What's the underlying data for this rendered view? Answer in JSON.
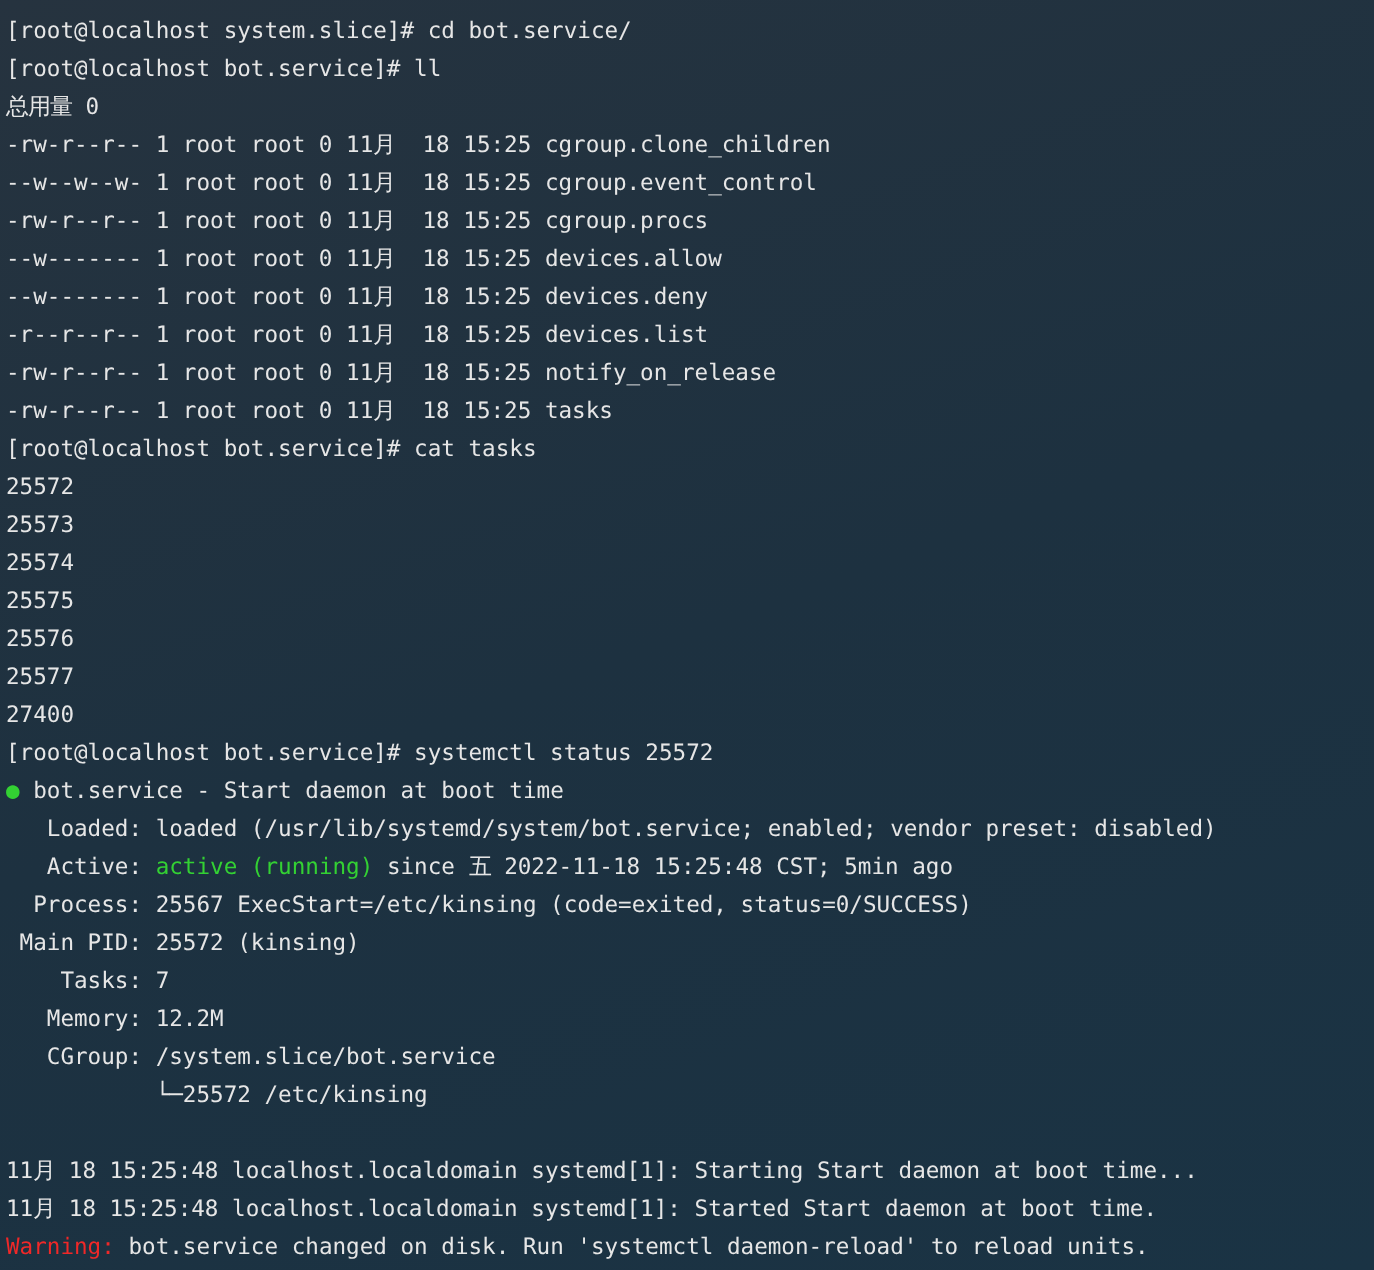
{
  "terminal": {
    "lines": [
      {
        "kind": "text",
        "segments": [
          {
            "text": "[root@localhost system.slice]# cd bot.service/"
          }
        ]
      },
      {
        "kind": "text",
        "segments": [
          {
            "text": "[root@localhost bot.service]# ll"
          }
        ]
      },
      {
        "kind": "text",
        "segments": [
          {
            "text": "总用量 0"
          }
        ]
      },
      {
        "kind": "text",
        "segments": [
          {
            "text": "-rw-r--r-- 1 root root 0 11月  18 15:25 cgroup.clone_children"
          }
        ]
      },
      {
        "kind": "text",
        "segments": [
          {
            "text": "--w--w--w- 1 root root 0 11月  18 15:25 cgroup.event_control"
          }
        ]
      },
      {
        "kind": "text",
        "segments": [
          {
            "text": "-rw-r--r-- 1 root root 0 11月  18 15:25 cgroup.procs"
          }
        ]
      },
      {
        "kind": "text",
        "segments": [
          {
            "text": "--w------- 1 root root 0 11月  18 15:25 devices.allow"
          }
        ]
      },
      {
        "kind": "text",
        "segments": [
          {
            "text": "--w------- 1 root root 0 11月  18 15:25 devices.deny"
          }
        ]
      },
      {
        "kind": "text",
        "segments": [
          {
            "text": "-r--r--r-- 1 root root 0 11月  18 15:25 devices.list"
          }
        ]
      },
      {
        "kind": "text",
        "segments": [
          {
            "text": "-rw-r--r-- 1 root root 0 11月  18 15:25 notify_on_release"
          }
        ]
      },
      {
        "kind": "text",
        "segments": [
          {
            "text": "-rw-r--r-- 1 root root 0 11月  18 15:25 tasks"
          }
        ]
      },
      {
        "kind": "text",
        "segments": [
          {
            "text": "[root@localhost bot.service]# cat tasks"
          }
        ]
      },
      {
        "kind": "text",
        "segments": [
          {
            "text": "25572"
          }
        ]
      },
      {
        "kind": "text",
        "segments": [
          {
            "text": "25573"
          }
        ]
      },
      {
        "kind": "text",
        "segments": [
          {
            "text": "25574"
          }
        ]
      },
      {
        "kind": "text",
        "segments": [
          {
            "text": "25575"
          }
        ]
      },
      {
        "kind": "text",
        "segments": [
          {
            "text": "25576"
          }
        ]
      },
      {
        "kind": "text",
        "segments": [
          {
            "text": "25577"
          }
        ]
      },
      {
        "kind": "text",
        "segments": [
          {
            "text": "27400"
          }
        ]
      },
      {
        "kind": "text",
        "segments": [
          {
            "text": "[root@localhost bot.service]# systemctl status 25572"
          }
        ]
      },
      {
        "kind": "text",
        "segments": [
          {
            "text": "●",
            "color": "#33d133"
          },
          {
            "text": " bot.service - Start daemon at boot time"
          }
        ]
      },
      {
        "kind": "text",
        "segments": [
          {
            "text": "   Loaded: loaded (/usr/lib/systemd/system/bot.service; enabled; vendor preset: disabled)"
          }
        ]
      },
      {
        "kind": "text",
        "segments": [
          {
            "text": "   Active: "
          },
          {
            "text": "active (running)",
            "color": "#33d133"
          },
          {
            "text": " since 五 2022-11-18 15:25:48 CST; 5min ago"
          }
        ]
      },
      {
        "kind": "text",
        "segments": [
          {
            "text": "  Process: 25567 ExecStart=/etc/kinsing (code=exited, status=0/SUCCESS)"
          }
        ]
      },
      {
        "kind": "text",
        "segments": [
          {
            "text": " Main PID: 25572 (kinsing)"
          }
        ]
      },
      {
        "kind": "text",
        "segments": [
          {
            "text": "    Tasks: 7"
          }
        ]
      },
      {
        "kind": "text",
        "segments": [
          {
            "text": "   Memory: 12.2M"
          }
        ]
      },
      {
        "kind": "text",
        "segments": [
          {
            "text": "   CGroup: /system.slice/bot.service"
          }
        ]
      },
      {
        "kind": "text",
        "segments": [
          {
            "text": "           └─25572 /etc/kinsing"
          }
        ]
      },
      {
        "kind": "blank"
      },
      {
        "kind": "text",
        "segments": [
          {
            "text": "11月 18 15:25:48 localhost.localdomain systemd[1]: Starting Start daemon at boot time..."
          }
        ]
      },
      {
        "kind": "text",
        "segments": [
          {
            "text": "11月 18 15:25:48 localhost.localdomain systemd[1]: Started Start daemon at boot time."
          }
        ]
      },
      {
        "kind": "text",
        "segments": [
          {
            "text": "Warning:",
            "color": "#f02828"
          },
          {
            "text": " bot.service changed on disk. Run 'systemctl daemon-reload' to reload units."
          }
        ]
      }
    ]
  }
}
